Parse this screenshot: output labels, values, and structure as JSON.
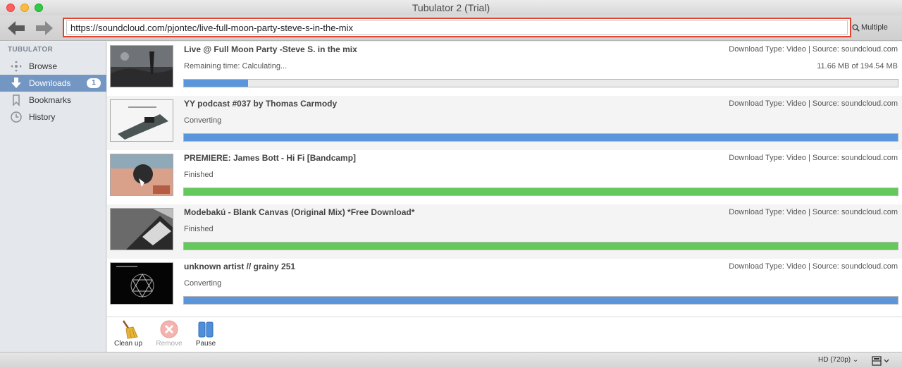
{
  "window": {
    "title": "Tubulator 2 (Trial)"
  },
  "toolbar": {
    "back_icon": "back-arrow-icon",
    "forward_icon": "forward-arrow-icon",
    "url_value": "https://soundcloud.com/pjontec/live-full-moon-party-steve-s-in-the-mix",
    "multiple_label": "Multiple",
    "multiple_icon": "search-icon"
  },
  "sidebar": {
    "heading": "TUBULATOR",
    "items": [
      {
        "label": "Browse",
        "icon": "browse-icon",
        "active": false
      },
      {
        "label": "Downloads",
        "icon": "download-icon",
        "active": true,
        "badge": "1"
      },
      {
        "label": "Bookmarks",
        "icon": "bookmark-icon",
        "active": false
      },
      {
        "label": "History",
        "icon": "clock-icon",
        "active": false
      }
    ],
    "active_color": "#7396c3"
  },
  "downloads": [
    {
      "title": "Live @ Full Moon Party -Steve S. in the mix",
      "meta": "Download Type: Video | Source: soundcloud.com",
      "status": "Remaining time: Calculating...",
      "size": "11.66 MB of 194.54 MB",
      "progress": 0.09,
      "color": "#5b96dc"
    },
    {
      "title": "YY podcast #037 by Thomas Carmody",
      "meta": "Download Type: Video | Source: soundcloud.com",
      "status": "Converting",
      "size": "",
      "progress": 1.0,
      "color": "#5b96dc"
    },
    {
      "title": "PREMIERE: James Bott - Hi Fi [Bandcamp]",
      "meta": "Download Type: Video | Source: soundcloud.com",
      "status": "Finished",
      "size": "",
      "progress": 1.0,
      "color": "#62c95a"
    },
    {
      "title": "Modebakú - Blank Canvas (Original Mix) *Free Download*",
      "meta": "Download Type: Video | Source: soundcloud.com",
      "status": "Finished",
      "size": "",
      "progress": 1.0,
      "color": "#62c95a"
    },
    {
      "title": "unknown artist // grainy 251",
      "meta": "Download Type: Video | Source: soundcloud.com",
      "status": "Converting",
      "size": "",
      "progress": 1.0,
      "color": "#5b96dc"
    }
  ],
  "actions": {
    "cleanup_label": "Clean up",
    "remove_label": "Remove",
    "pause_label": "Pause"
  },
  "statusbar": {
    "quality_label": "HD (720p)",
    "view_icon": "layout-icon"
  }
}
